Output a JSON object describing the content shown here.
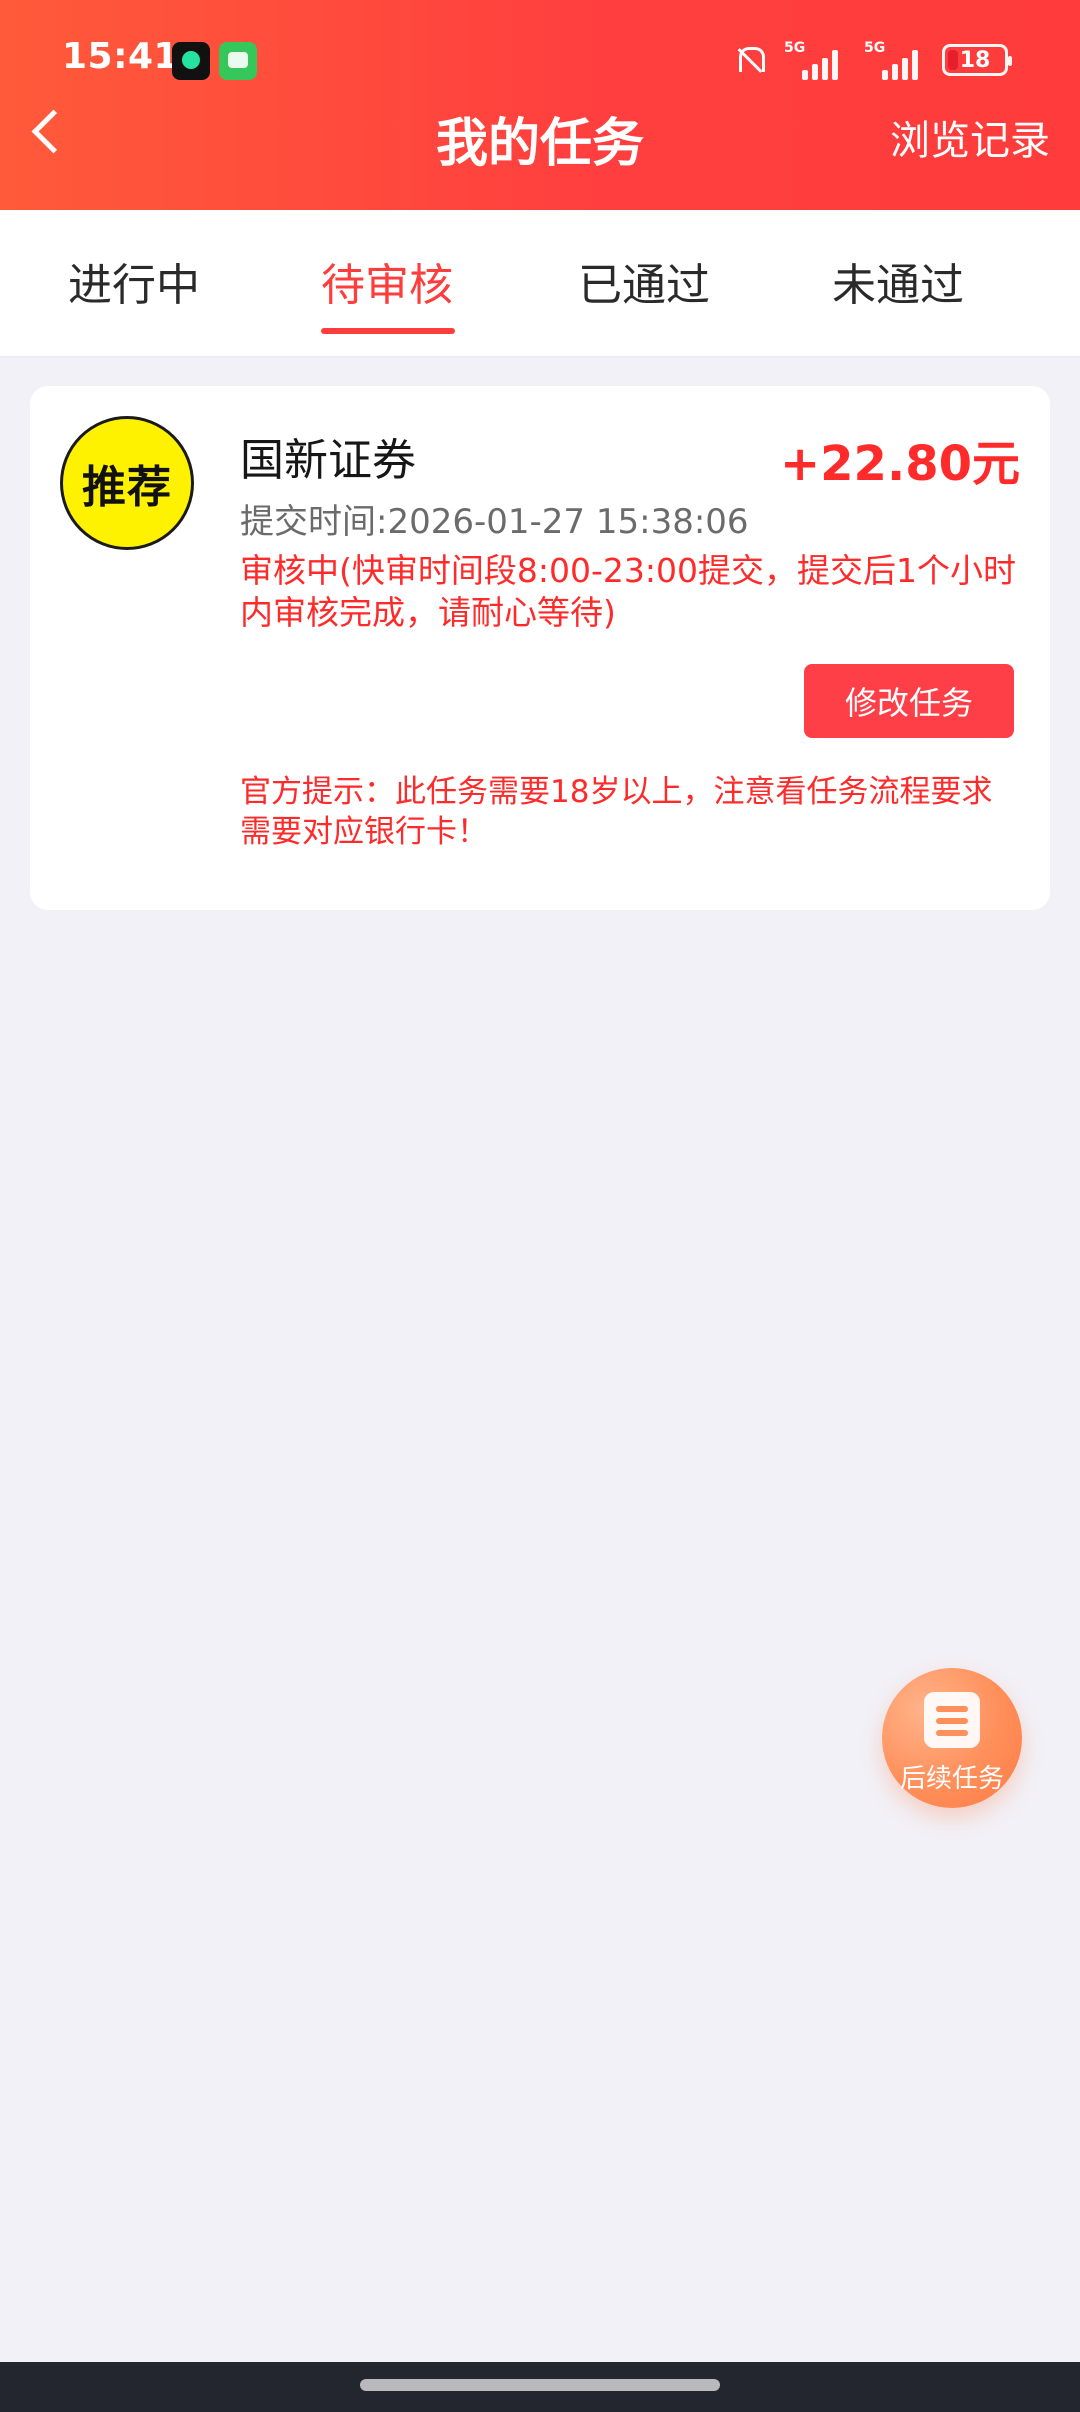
{
  "status_bar": {
    "time": "15:41",
    "signals": [
      {
        "label": "5G"
      },
      {
        "label": "5G"
      }
    ],
    "battery": {
      "percent": 18,
      "text": "18"
    }
  },
  "header": {
    "title": "我的任务",
    "right_link": "浏览记录"
  },
  "tabs": [
    {
      "label": "进行中"
    },
    {
      "label": "待审核"
    },
    {
      "label": "已通过"
    },
    {
      "label": "未通过"
    }
  ],
  "task": {
    "badge_text": "推荐",
    "name": "国新证券",
    "reward": "+22.80元",
    "submit_time": "提交时间:2026-01-27 15:38:06",
    "status": "审核中(快审时间段8:00-23:00提交，提交后1个小时内审核完成，请耐心等待)",
    "edit_button": "修改任务",
    "official_tip": "官方提示：此任务需要18岁以上，注意看任务流程要求需要对应银行卡！"
  },
  "fab": {
    "label": "后续任务"
  },
  "colors": {
    "accent": "#ff3d3d",
    "header_start": "#ff5a3a",
    "header_end": "#ff3b3b",
    "background": "#f2f1f7",
    "card": "#ffffff",
    "badge_yellow": "#fff200",
    "fab_orange": "#ff8f5a"
  },
  "icons": {
    "back": "chevron-left-icon",
    "bell_off": "bell-off-icon",
    "signal": "signal-bars-icon",
    "battery": "battery-icon",
    "fab": "document-list-icon"
  }
}
